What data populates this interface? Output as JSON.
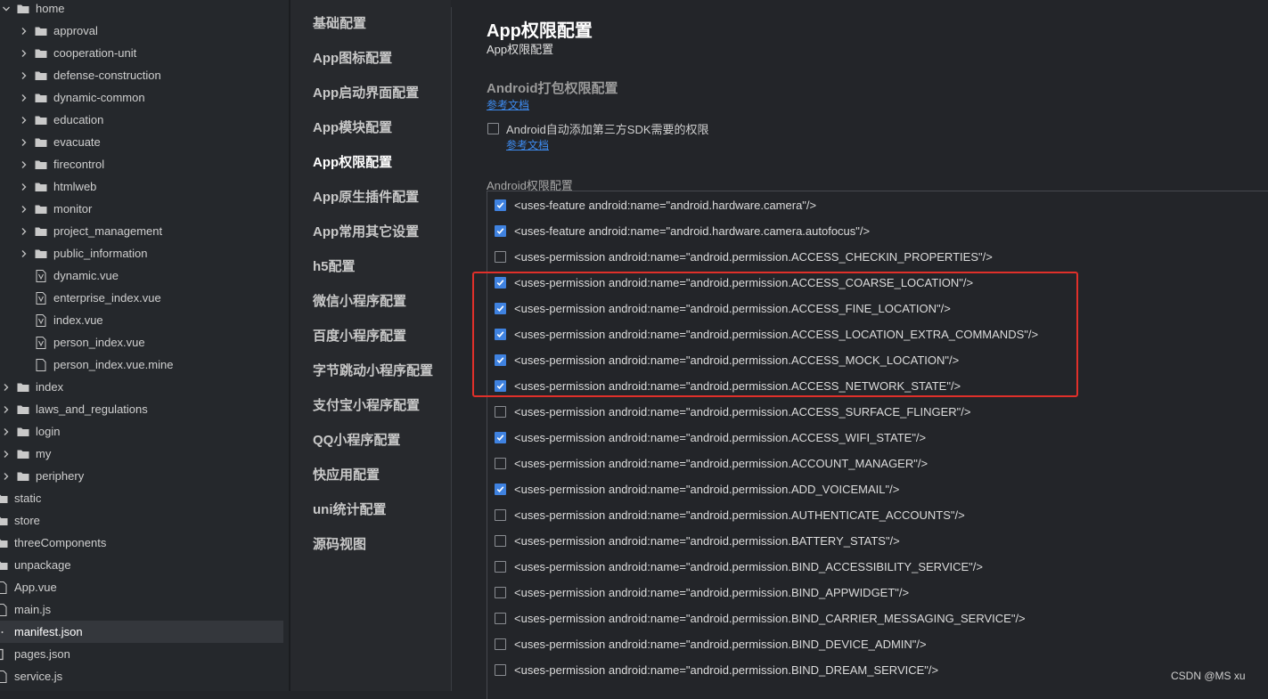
{
  "file_tree": [
    {
      "label": "home",
      "depth": 0,
      "type": "folder",
      "expanded": true
    },
    {
      "label": "approval",
      "depth": 1,
      "type": "folder",
      "expanded": false
    },
    {
      "label": "cooperation-unit",
      "depth": 1,
      "type": "folder",
      "expanded": false
    },
    {
      "label": "defense-construction",
      "depth": 1,
      "type": "folder",
      "expanded": false
    },
    {
      "label": "dynamic-common",
      "depth": 1,
      "type": "folder",
      "expanded": false
    },
    {
      "label": "education",
      "depth": 1,
      "type": "folder",
      "expanded": false
    },
    {
      "label": "evacuate",
      "depth": 1,
      "type": "folder",
      "expanded": false
    },
    {
      "label": "firecontrol",
      "depth": 1,
      "type": "folder",
      "expanded": false
    },
    {
      "label": "htmlweb",
      "depth": 1,
      "type": "folder",
      "expanded": false
    },
    {
      "label": "monitor",
      "depth": 1,
      "type": "folder",
      "expanded": false
    },
    {
      "label": "project_management",
      "depth": 1,
      "type": "folder",
      "expanded": false
    },
    {
      "label": "public_information",
      "depth": 1,
      "type": "folder",
      "expanded": false
    },
    {
      "label": "dynamic.vue",
      "depth": 1,
      "type": "vue"
    },
    {
      "label": "enterprise_index.vue",
      "depth": 1,
      "type": "vue"
    },
    {
      "label": "index.vue",
      "depth": 1,
      "type": "vue"
    },
    {
      "label": "person_index.vue",
      "depth": 1,
      "type": "vue"
    },
    {
      "label": "person_index.vue.mine",
      "depth": 1,
      "type": "file"
    },
    {
      "label": "index",
      "depth": 0,
      "type": "folder",
      "expanded": false
    },
    {
      "label": "laws_and_regulations",
      "depth": 0,
      "type": "folder",
      "expanded": false
    },
    {
      "label": "login",
      "depth": 0,
      "type": "folder",
      "expanded": false
    },
    {
      "label": "my",
      "depth": 0,
      "type": "folder",
      "expanded": false
    },
    {
      "label": "periphery",
      "depth": 0,
      "type": "folder",
      "expanded": false
    },
    {
      "label": "static",
      "depth": -1,
      "type": "folder-plain"
    },
    {
      "label": "store",
      "depth": -1,
      "type": "folder-plain"
    },
    {
      "label": "threeComponents",
      "depth": -1,
      "type": "folder-plain"
    },
    {
      "label": "unpackage",
      "depth": -1,
      "type": "folder-plain"
    },
    {
      "label": "App.vue",
      "depth": -1,
      "type": "file-plain"
    },
    {
      "label": "main.js",
      "depth": -1,
      "type": "file-plain"
    },
    {
      "label": "manifest.json",
      "depth": -1,
      "type": "json",
      "selected": true
    },
    {
      "label": "pages.json",
      "depth": -1,
      "type": "bracket"
    },
    {
      "label": "service.js",
      "depth": -1,
      "type": "file-plain"
    }
  ],
  "nav": {
    "active_index": 4,
    "items": [
      "基础配置",
      "App图标配置",
      "App启动界面配置",
      "App模块配置",
      "App权限配置",
      "App原生插件配置",
      "App常用其它设置",
      "h5配置",
      "微信小程序配置",
      "百度小程序配置",
      "字节跳动小程序配置",
      "支付宝小程序配置",
      "QQ小程序配置",
      "快应用配置",
      "uni统计配置",
      "源码视图"
    ]
  },
  "main": {
    "title": "App权限配置",
    "subtitle": "App权限配置",
    "section_title": "Android打包权限配置",
    "section_link": "参考文档",
    "auto_add": {
      "label": "Android自动添加第三方SDK需要的权限",
      "checked": false,
      "link": "参考文档"
    },
    "permissions_label": "Android权限配置",
    "permissions": [
      {
        "text": "<uses-feature android:name=\"android.hardware.camera\"/>",
        "checked": true
      },
      {
        "text": "<uses-feature android:name=\"android.hardware.camera.autofocus\"/>",
        "checked": true
      },
      {
        "text": "<uses-permission android:name=\"android.permission.ACCESS_CHECKIN_PROPERTIES\"/>",
        "checked": false
      },
      {
        "text": "<uses-permission android:name=\"android.permission.ACCESS_COARSE_LOCATION\"/>",
        "checked": true
      },
      {
        "text": "<uses-permission android:name=\"android.permission.ACCESS_FINE_LOCATION\"/>",
        "checked": true
      },
      {
        "text": "<uses-permission android:name=\"android.permission.ACCESS_LOCATION_EXTRA_COMMANDS\"/>",
        "checked": true
      },
      {
        "text": "<uses-permission android:name=\"android.permission.ACCESS_MOCK_LOCATION\"/>",
        "checked": true
      },
      {
        "text": "<uses-permission android:name=\"android.permission.ACCESS_NETWORK_STATE\"/>",
        "checked": true
      },
      {
        "text": "<uses-permission android:name=\"android.permission.ACCESS_SURFACE_FLINGER\"/>",
        "checked": false
      },
      {
        "text": "<uses-permission android:name=\"android.permission.ACCESS_WIFI_STATE\"/>",
        "checked": true
      },
      {
        "text": "<uses-permission android:name=\"android.permission.ACCOUNT_MANAGER\"/>",
        "checked": false
      },
      {
        "text": "<uses-permission android:name=\"android.permission.ADD_VOICEMAIL\"/>",
        "checked": true
      },
      {
        "text": "<uses-permission android:name=\"android.permission.AUTHENTICATE_ACCOUNTS\"/>",
        "checked": false
      },
      {
        "text": "<uses-permission android:name=\"android.permission.BATTERY_STATS\"/>",
        "checked": false
      },
      {
        "text": "<uses-permission android:name=\"android.permission.BIND_ACCESSIBILITY_SERVICE\"/>",
        "checked": false
      },
      {
        "text": "<uses-permission android:name=\"android.permission.BIND_APPWIDGET\"/>",
        "checked": false
      },
      {
        "text": "<uses-permission android:name=\"android.permission.BIND_CARRIER_MESSAGING_SERVICE\"/>",
        "checked": false
      },
      {
        "text": "<uses-permission android:name=\"android.permission.BIND_DEVICE_ADMIN\"/>",
        "checked": false
      },
      {
        "text": "<uses-permission android:name=\"android.permission.BIND_DREAM_SERVICE\"/>",
        "checked": false
      }
    ],
    "highlight": {
      "color": "#e0302a",
      "first_index": 3,
      "last_index": 7
    }
  },
  "watermark": "CSDN @MS    xu",
  "colors": {
    "accent": "#3f82e0",
    "link": "#3d8bf0",
    "highlight": "#e0302a"
  }
}
